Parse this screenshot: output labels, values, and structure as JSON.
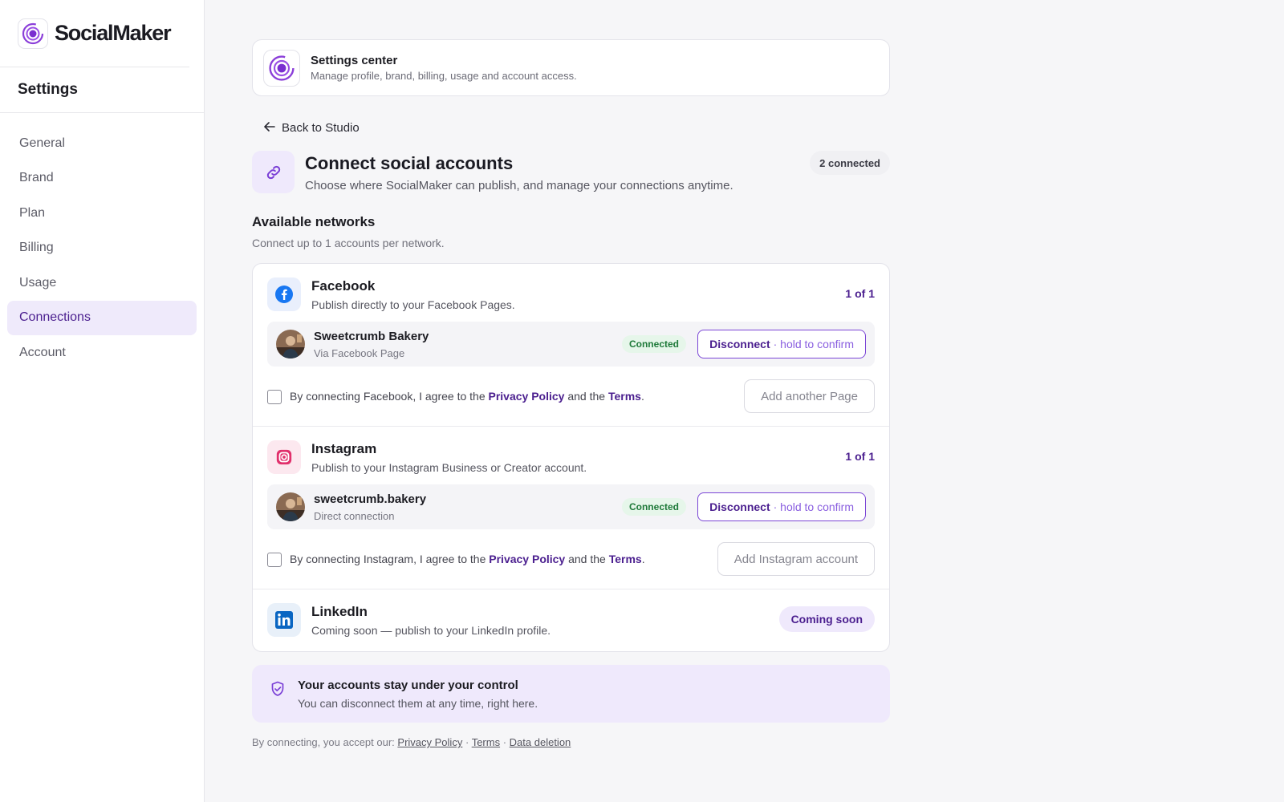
{
  "sidebar": {
    "brand_name": "SocialMaker",
    "title": "Settings",
    "items": [
      {
        "label": "General"
      },
      {
        "label": "Brand"
      },
      {
        "label": "Plan"
      },
      {
        "label": "Billing"
      },
      {
        "label": "Usage"
      },
      {
        "label": "Connections",
        "active": true
      },
      {
        "label": "Account"
      }
    ]
  },
  "settings_card": {
    "title": "Settings center",
    "subtitle": "Manage profile, brand, billing, usage and account access."
  },
  "back_link": "Back to Studio",
  "header": {
    "title": "Connect social accounts",
    "subtitle": "Choose where SocialMaker can publish, and manage your connections anytime.",
    "badge": "2 connected"
  },
  "available": {
    "title": "Available networks",
    "subtitle": "Connect up to 1 accounts per network."
  },
  "networks": {
    "facebook": {
      "name": "Facebook",
      "desc": "Publish directly to your Facebook Pages.",
      "count": "1 of 1",
      "account": {
        "name": "Sweetcrumb Bakery",
        "via": "Via Facebook Page",
        "status": "Connected"
      },
      "disconnect": {
        "label": "Disconnect",
        "hint": "· hold to confirm"
      },
      "consent": {
        "prefix": "By connecting Facebook, I agree to the",
        "privacy": "Privacy Policy",
        "and": "and the",
        "terms": "Terms",
        "suffix": "."
      },
      "add_label": "Add another Page"
    },
    "instagram": {
      "name": "Instagram",
      "desc": "Publish to your Instagram Business or Creator account.",
      "count": "1 of 1",
      "account": {
        "name": "sweetcrumb.bakery",
        "via": "Direct connection",
        "status": "Connected"
      },
      "disconnect": {
        "label": "Disconnect",
        "hint": "· hold to confirm"
      },
      "consent": {
        "prefix": "By connecting Instagram, I agree to the",
        "privacy": "Privacy Policy",
        "and": "and the",
        "terms": "Terms",
        "suffix": "."
      },
      "add_label": "Add Instagram account"
    },
    "linkedin": {
      "name": "LinkedIn",
      "desc": "Coming soon — publish to your LinkedIn profile.",
      "badge": "Coming soon"
    }
  },
  "control": {
    "title": "Your accounts stay under your control",
    "subtitle": "You can disconnect them at any time, right here."
  },
  "footer": {
    "prefix": "By connecting, you accept our:",
    "privacy": "Privacy Policy",
    "sep": "·",
    "terms": "Terms",
    "deletion": "Data deletion"
  },
  "colors": {
    "accent": "#4b1f8f",
    "accent_light": "#efe9fc",
    "connected_bg": "#e6f6ea",
    "connected_text": "#1f7a3a",
    "facebook": "#1877f2",
    "instagram": "#e1306c",
    "linkedin": "#0a66c2"
  },
  "icons": {
    "brand": "socialmaker-logo-icon",
    "back": "arrow-left-icon",
    "header": "link-icon",
    "facebook": "facebook-icon",
    "instagram": "instagram-icon",
    "linkedin": "linkedin-icon",
    "control": "shield-check-icon"
  }
}
